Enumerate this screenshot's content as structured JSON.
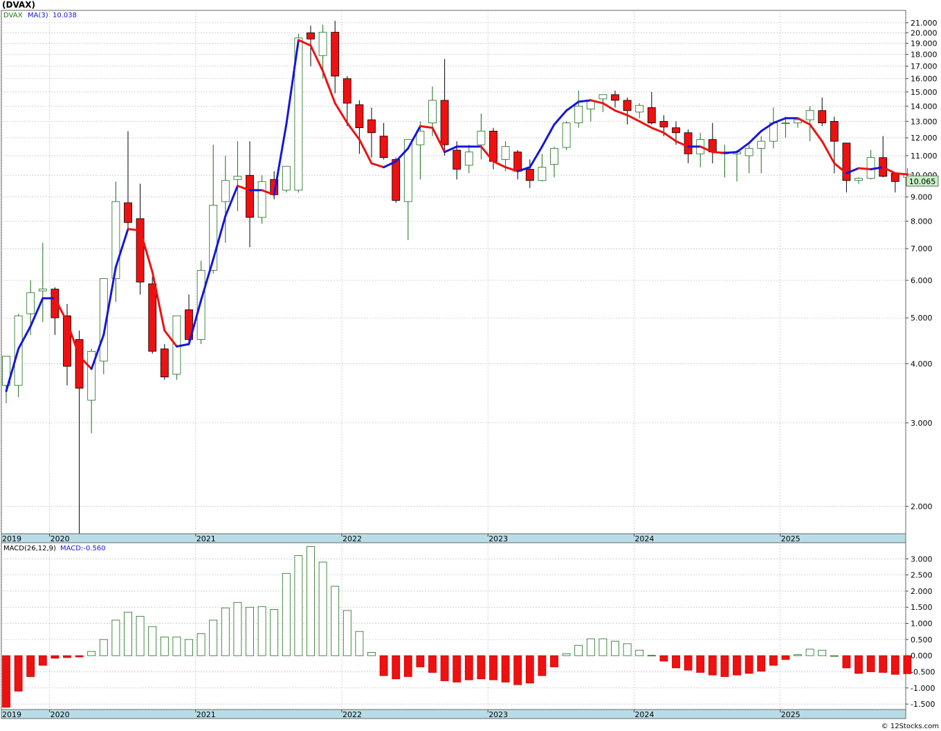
{
  "header": {
    "title": "(DVAX)",
    "legend_symbol": "DVAX",
    "legend_ma_label": "MA(3)",
    "legend_ma_value": "10.038",
    "macd_label": "MACD(26,12,9)",
    "macd_value_label": "MACD:-0.560",
    "last_price_tag": "10.065",
    "watermark": "© 12Stocks.com"
  },
  "colors": {
    "up_candle": "#1a6b1a",
    "down_candle": "#ee1111",
    "ma_up": "#1515dd",
    "ma_down": "#ee1111",
    "axis_band": "#b9dde6",
    "grid": "#c8c8c8",
    "price_tag_bg": "#c8f0c8"
  },
  "chart_data": [
    {
      "type": "candlestick",
      "title": "(DVAX)",
      "scale": "log",
      "ylim": [
        1.75,
        22.3
      ],
      "y_ticks": [
        "2.000",
        "3.000",
        "4.000",
        "5.000",
        "6.000",
        "7.000",
        "8.000",
        "9.000",
        "10.000",
        "11.000",
        "12.000",
        "13.000",
        "14.000",
        "15.000",
        "16.000",
        "17.000",
        "18.000",
        "19.000",
        "20.000",
        "21.000"
      ],
      "x_labels": [
        "2019",
        "2020",
        "2021",
        "2022",
        "2023",
        "2024",
        "2025"
      ],
      "series": [
        {
          "name": "DVAX",
          "ohlc": [
            [
              3.6,
              4.15,
              3.3,
              4.15
            ],
            [
              3.6,
              5.1,
              3.4,
              5.05
            ],
            [
              5.1,
              6.0,
              4.6,
              5.65
            ],
            [
              5.7,
              7.2,
              4.9,
              5.75
            ],
            [
              5.75,
              5.8,
              4.6,
              5.0
            ],
            [
              5.05,
              5.35,
              3.6,
              3.95
            ],
            [
              4.5,
              4.7,
              1.7,
              3.55
            ],
            [
              3.35,
              4.3,
              2.85,
              4.25
            ],
            [
              4.05,
              5.6,
              3.8,
              6.05
            ],
            [
              6.05,
              9.7,
              5.4,
              8.8
            ],
            [
              8.75,
              12.4,
              7.6,
              7.95
            ],
            [
              8.1,
              9.6,
              5.6,
              5.95
            ],
            [
              5.9,
              6.1,
              4.2,
              4.25
            ],
            [
              4.3,
              4.4,
              3.7,
              3.75
            ],
            [
              3.8,
              5.05,
              3.7,
              5.05
            ],
            [
              5.2,
              5.6,
              4.4,
              4.5
            ],
            [
              4.5,
              6.6,
              4.4,
              6.3
            ],
            [
              6.3,
              11.6,
              6.2,
              8.65
            ],
            [
              8.8,
              11.0,
              7.2,
              9.75
            ],
            [
              9.8,
              11.8,
              8.4,
              9.95
            ],
            [
              10.0,
              11.8,
              7.05,
              8.15
            ],
            [
              8.15,
              10.0,
              7.9,
              9.7
            ],
            [
              9.8,
              10.2,
              8.9,
              9.1
            ],
            [
              9.3,
              10.4,
              9.2,
              10.45
            ],
            [
              9.3,
              19.9,
              9.2,
              19.5
            ],
            [
              20.0,
              20.7,
              17.0,
              19.4
            ],
            [
              17.9,
              20.8,
              16.0,
              20.05
            ],
            [
              20.05,
              21.2,
              14.9,
              16.2
            ],
            [
              16.0,
              16.2,
              12.7,
              14.2
            ],
            [
              14.1,
              14.4,
              11.1,
              12.6
            ],
            [
              13.1,
              13.9,
              10.9,
              12.3
            ],
            [
              12.1,
              12.9,
              10.8,
              10.9
            ],
            [
              10.8,
              10.9,
              8.75,
              8.85
            ],
            [
              8.8,
              11.9,
              7.3,
              11.9
            ],
            [
              11.6,
              13.0,
              9.8,
              12.4
            ],
            [
              12.9,
              15.4,
              12.1,
              14.4
            ],
            [
              14.4,
              17.6,
              11.0,
              11.6
            ],
            [
              11.3,
              11.8,
              9.8,
              10.3
            ],
            [
              10.5,
              11.6,
              10.1,
              11.2
            ],
            [
              11.6,
              13.5,
              10.8,
              12.4
            ],
            [
              12.4,
              12.6,
              10.3,
              10.7
            ],
            [
              10.8,
              11.8,
              10.2,
              11.5
            ],
            [
              11.2,
              11.3,
              9.8,
              10.2
            ],
            [
              10.3,
              10.8,
              9.4,
              9.75
            ],
            [
              9.75,
              11.1,
              9.7,
              10.4
            ],
            [
              10.55,
              11.5,
              9.9,
              11.4
            ],
            [
              11.45,
              13.0,
              11.3,
              12.9
            ],
            [
              12.9,
              15.1,
              12.6,
              14.0
            ],
            [
              13.8,
              14.5,
              13.0,
              14.4
            ],
            [
              14.5,
              14.8,
              13.6,
              14.8
            ],
            [
              14.8,
              15.1,
              13.9,
              14.4
            ],
            [
              14.4,
              14.6,
              12.8,
              13.7
            ],
            [
              13.6,
              14.2,
              13.2,
              14.05
            ],
            [
              13.9,
              15.0,
              12.8,
              12.9
            ],
            [
              13.0,
              13.4,
              12.1,
              12.65
            ],
            [
              12.6,
              13.0,
              11.6,
              12.3
            ],
            [
              12.3,
              12.5,
              10.6,
              11.1
            ],
            [
              11.1,
              12.3,
              10.4,
              11.9
            ],
            [
              11.9,
              12.9,
              10.6,
              11.2
            ],
            [
              11.1,
              11.6,
              9.9,
              11.2
            ],
            [
              11.1,
              11.3,
              9.7,
              11.2
            ],
            [
              11.0,
              11.6,
              10.1,
              11.4
            ],
            [
              11.4,
              12.1,
              10.1,
              11.8
            ],
            [
              11.8,
              13.9,
              11.4,
              12.9
            ],
            [
              12.9,
              13.3,
              12.0,
              12.9
            ],
            [
              12.9,
              13.2,
              12.6,
              13.1
            ],
            [
              13.1,
              14.0,
              11.8,
              13.7
            ],
            [
              13.7,
              14.6,
              12.7,
              12.9
            ],
            [
              13.0,
              13.3,
              10.1,
              11.8
            ],
            [
              11.7,
              11.7,
              9.2,
              9.75
            ],
            [
              9.75,
              9.9,
              9.6,
              9.85
            ],
            [
              9.85,
              11.3,
              9.8,
              10.9
            ],
            [
              10.9,
              12.1,
              9.9,
              9.95
            ],
            [
              10.1,
              10.1,
              9.2,
              9.7
            ],
            [
              9.9,
              10.35,
              9.8,
              10.06
            ]
          ]
        },
        {
          "name": "MA(3)",
          "values": [
            3.5,
            4.3,
            4.8,
            5.5,
            5.5,
            4.9,
            4.15,
            3.9,
            4.6,
            6.4,
            7.7,
            7.65,
            6.25,
            4.7,
            4.35,
            4.4,
            5.45,
            6.65,
            8.2,
            9.5,
            9.3,
            9.3,
            9.1,
            12.8,
            19.3,
            18.8,
            16.6,
            14.2,
            12.9,
            11.9,
            10.6,
            10.4,
            10.7,
            11.4,
            12.7,
            12.6,
            11.2,
            11.5,
            11.5,
            11.5,
            10.7,
            10.4,
            10.2,
            10.4,
            11.5,
            12.8,
            13.7,
            14.3,
            14.4,
            14.2,
            13.7,
            13.4,
            13.0,
            12.6,
            12.3,
            11.8,
            11.5,
            11.5,
            11.2,
            11.15,
            11.2,
            11.7,
            12.4,
            12.9,
            13.2,
            13.2,
            12.8,
            11.8,
            10.6,
            10.1,
            10.35,
            10.3,
            10.4,
            10.1,
            10.04
          ]
        }
      ]
    },
    {
      "type": "bar",
      "title": "MACD(26,12,9)",
      "ylim": [
        -1.67,
        3.5
      ],
      "y_ticks": [
        "-1.500",
        "-1.000",
        "-0.500",
        "0.000",
        "0.500",
        "1.000",
        "1.500",
        "2.000",
        "2.500",
        "3.000"
      ],
      "x_labels": [
        "2019",
        "2020",
        "2021",
        "2022",
        "2023",
        "2024",
        "2025"
      ],
      "series": [
        {
          "name": "MACD",
          "values": [
            -1.6,
            -1.1,
            -0.65,
            -0.3,
            -0.08,
            -0.06,
            -0.04,
            0.13,
            0.5,
            1.1,
            1.35,
            1.22,
            0.9,
            0.58,
            0.58,
            0.5,
            0.68,
            1.1,
            1.48,
            1.65,
            1.5,
            1.52,
            1.43,
            2.55,
            3.1,
            3.38,
            2.9,
            2.15,
            1.4,
            0.75,
            0.1,
            -0.62,
            -0.72,
            -0.65,
            -0.35,
            -0.52,
            -0.78,
            -0.82,
            -0.75,
            -0.72,
            -0.75,
            -0.82,
            -0.9,
            -0.85,
            -0.62,
            -0.35,
            0.06,
            0.32,
            0.52,
            0.52,
            0.45,
            0.37,
            0.17,
            0.01,
            -0.17,
            -0.38,
            -0.45,
            -0.52,
            -0.6,
            -0.65,
            -0.6,
            -0.55,
            -0.48,
            -0.3,
            -0.12,
            0.03,
            0.2,
            0.17,
            0.0,
            -0.38,
            -0.55,
            -0.5,
            -0.52,
            -0.58,
            -0.56
          ]
        }
      ]
    }
  ]
}
